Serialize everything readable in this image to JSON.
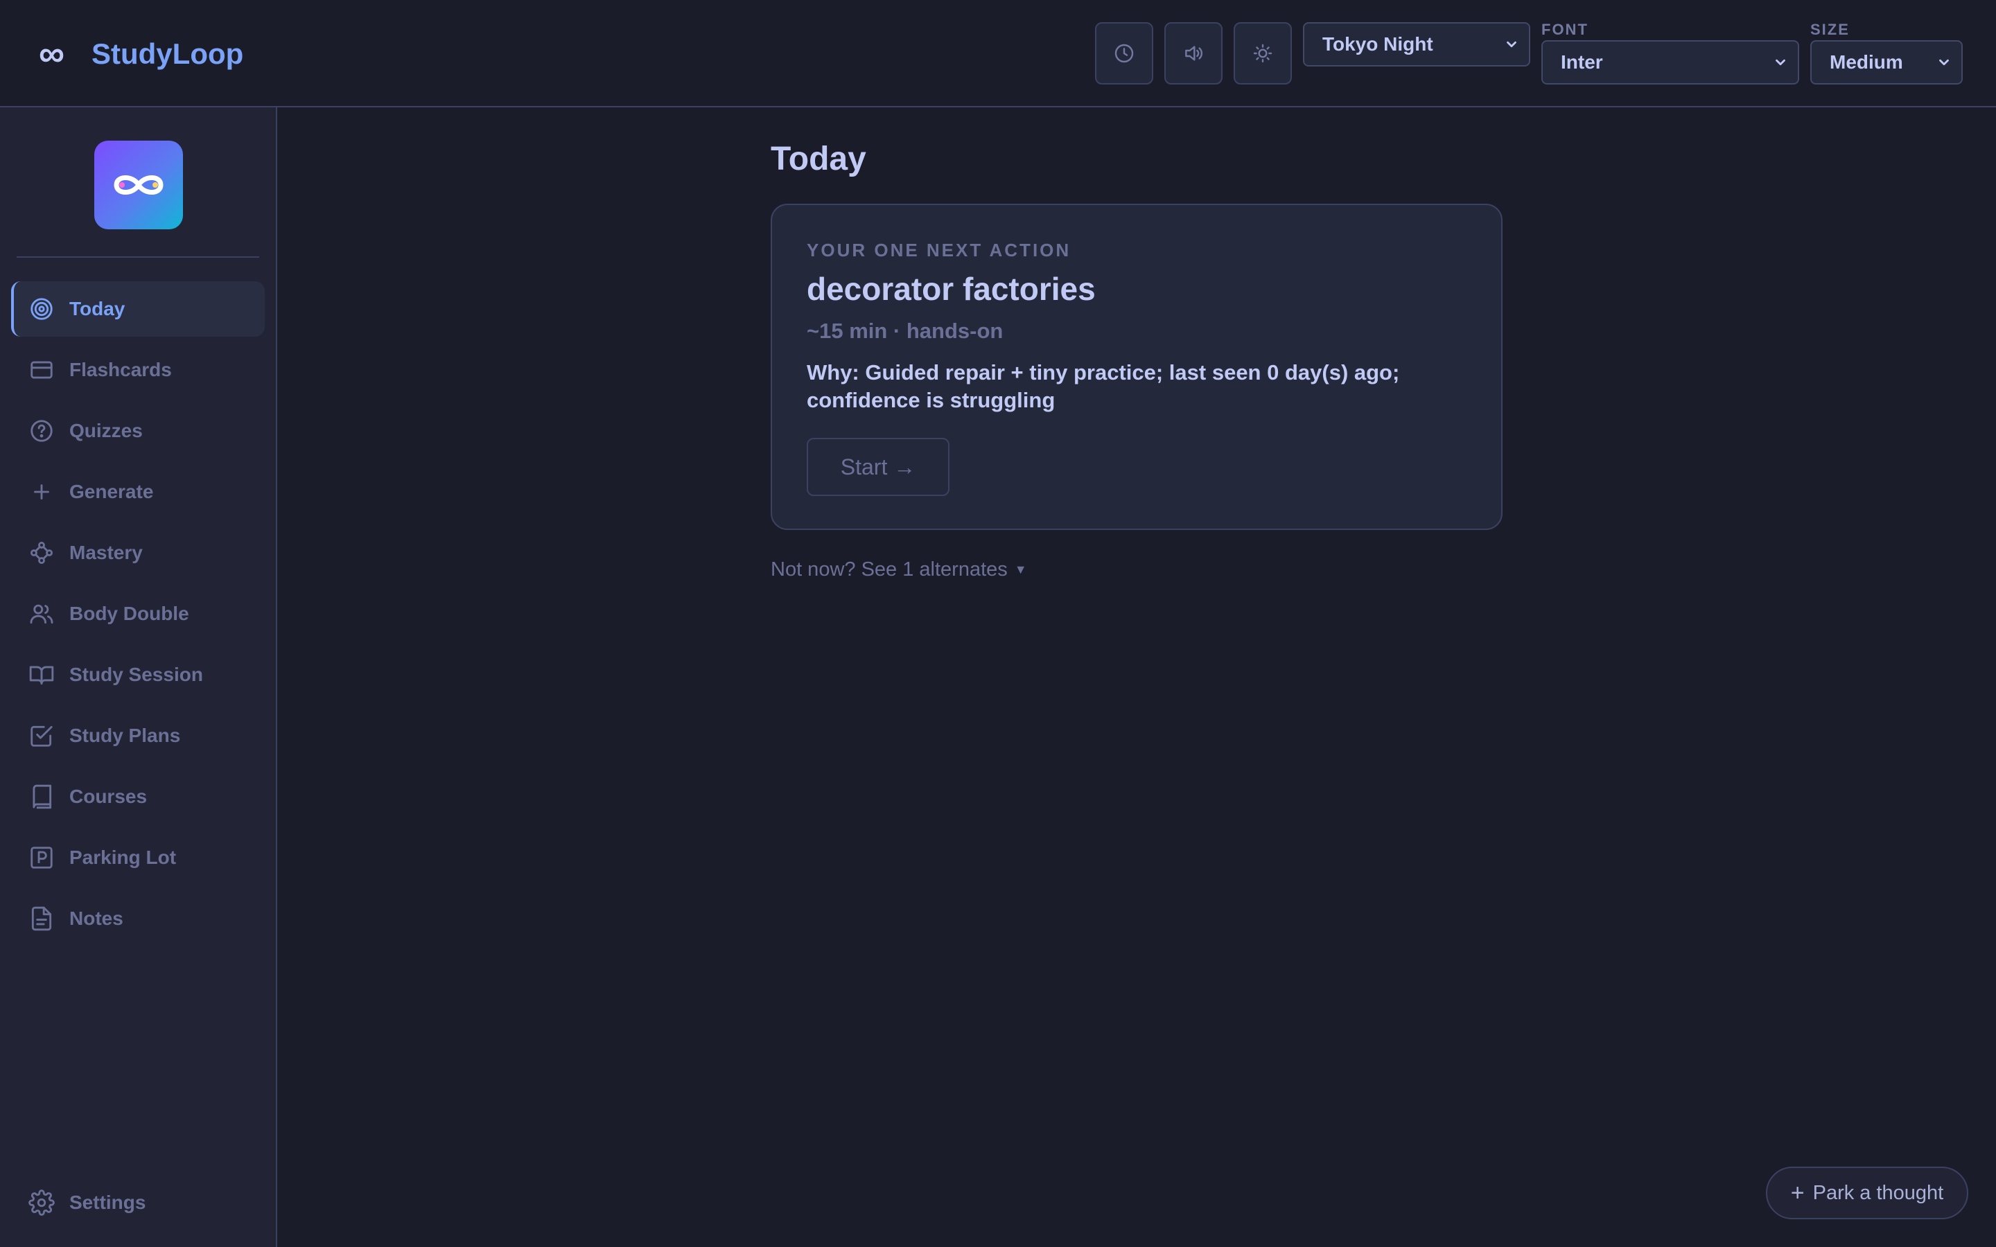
{
  "header": {
    "brand_mark": "∞",
    "brand_name": "StudyLoop",
    "buttons": [
      {
        "icon": "clock-icon"
      },
      {
        "icon": "speaker-icon"
      },
      {
        "icon": "sun-icon"
      }
    ],
    "theme": {
      "value": "Tokyo Night"
    },
    "font": {
      "label": "FONT",
      "value": "Inter"
    },
    "size": {
      "label": "SIZE",
      "value": "Medium"
    }
  },
  "sidebar": {
    "items": [
      {
        "label": "Today",
        "icon": "target-icon",
        "active": true
      },
      {
        "label": "Flashcards",
        "icon": "card-icon"
      },
      {
        "label": "Quizzes",
        "icon": "help-circle-icon"
      },
      {
        "label": "Generate",
        "icon": "plus-icon"
      },
      {
        "label": "Mastery",
        "icon": "network-icon"
      },
      {
        "label": "Body Double",
        "icon": "users-icon"
      },
      {
        "label": "Study Session",
        "icon": "open-book-icon"
      },
      {
        "label": "Study Plans",
        "icon": "check-square-icon"
      },
      {
        "label": "Courses",
        "icon": "book-icon"
      },
      {
        "label": "Parking Lot",
        "icon": "parking-icon"
      },
      {
        "label": "Notes",
        "icon": "file-text-icon"
      }
    ],
    "settings": {
      "label": "Settings",
      "icon": "gear-icon"
    }
  },
  "main": {
    "title": "Today",
    "card": {
      "eyebrow": "YOUR ONE NEXT ACTION",
      "title": "decorator factories",
      "meta": "~15 min · hands-on",
      "why": "Why: Guided repair + tiny practice; last seen 0 day(s) ago; confidence is struggling",
      "start_label": "Start →"
    },
    "alternates": "Not now? See 1 alternates",
    "park_label": "Park a thought"
  },
  "colors": {
    "background": "#1b1c29",
    "sidebar": "#222436",
    "accent": "#7aa2f7",
    "muted": "#6b7196",
    "text": "#c0caf5"
  }
}
